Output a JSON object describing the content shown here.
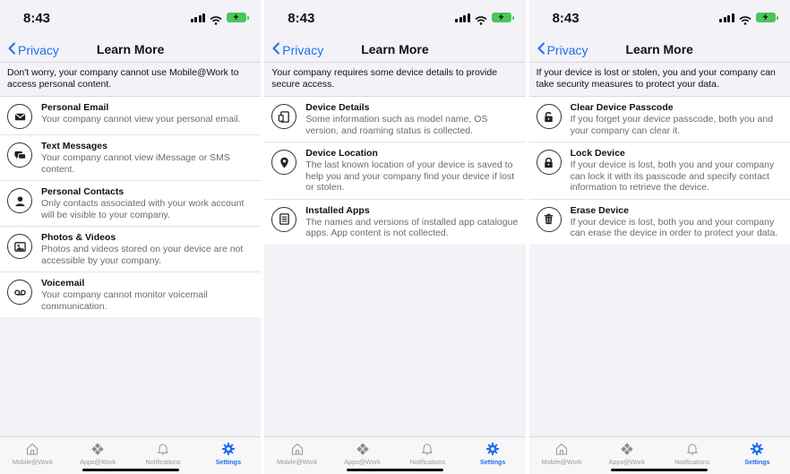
{
  "status": {
    "time": "8:43"
  },
  "nav": {
    "back_label": "Privacy",
    "title": "Learn More"
  },
  "screens": [
    {
      "intro": "Don't worry, your company cannot use Mobile@Work to access personal content.",
      "items": [
        {
          "icon": "envelope-icon",
          "title": "Personal Email",
          "desc": "Your company cannot view your personal email."
        },
        {
          "icon": "chat-bubbles-icon",
          "title": "Text Messages",
          "desc": "Your company cannot view iMessage or SMS content."
        },
        {
          "icon": "person-icon",
          "title": "Personal Contacts",
          "desc": "Only contacts associated with your work account will be visible to your company."
        },
        {
          "icon": "photos-icon",
          "title": "Photos & Videos",
          "desc": "Photos and videos stored on your device are not accessible by your company."
        },
        {
          "icon": "voicemail-icon",
          "title": "Voicemail",
          "desc": "Your company cannot monitor voicemail communication."
        }
      ]
    },
    {
      "intro": "Your company requires some device details to provide secure access.",
      "items": [
        {
          "icon": "device-icon",
          "title": "Device Details",
          "desc": "Some information such as model name, OS version, and roaming status is collected."
        },
        {
          "icon": "location-pin-icon",
          "title": "Device Location",
          "desc": "The last known location of your device is saved to help you and your company find your device if lost or stolen."
        },
        {
          "icon": "apps-stack-icon",
          "title": "Installed Apps",
          "desc": "The names and versions of installed app catalogue apps. App content is not collected."
        }
      ]
    },
    {
      "intro": "If your device is lost or stolen, you and your company can take security measures to protect your data.",
      "items": [
        {
          "icon": "unlock-icon",
          "title": "Clear Device Passcode",
          "desc": "If you forget your device passcode, both you and your company can clear it."
        },
        {
          "icon": "lock-icon",
          "title": "Lock Device",
          "desc": "If your device is lost, both you and your company can lock it with its passcode and specify contact information to retrieve the device."
        },
        {
          "icon": "trash-icon",
          "title": "Erase Device",
          "desc": "If your device is lost, both you and your company can erase the device in order to protect your data."
        }
      ]
    }
  ],
  "tabs": [
    {
      "icon": "home-icon",
      "label": "Mobile@Work"
    },
    {
      "icon": "apps-icon",
      "label": "Apps@Work"
    },
    {
      "icon": "bell-icon",
      "label": "Notifications"
    },
    {
      "icon": "gear-icon",
      "label": "Settings",
      "active": true
    }
  ],
  "colors": {
    "accent": "#1f6ff2",
    "background": "#f2f2f7",
    "battery": "#49c659"
  }
}
